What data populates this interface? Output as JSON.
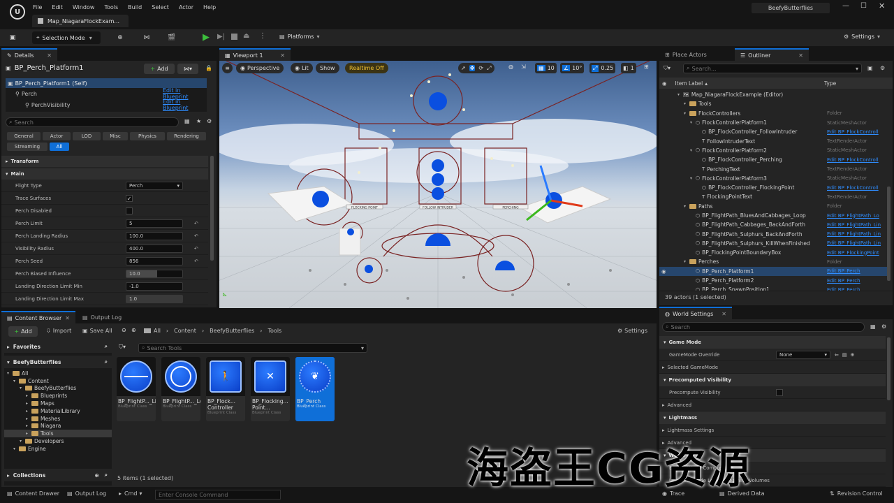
{
  "titlebar": {
    "menus": [
      "File",
      "Edit",
      "Window",
      "Tools",
      "Build",
      "Select",
      "Actor",
      "Help"
    ],
    "project_name": "BeefyButterflies",
    "map_tab": "Map_NiagaraFlockExam..."
  },
  "toolbar": {
    "selection_mode": "Selection Mode",
    "platforms": "Platforms",
    "settings": "Settings"
  },
  "details": {
    "tab": "Details",
    "actor_name": "BP_Perch_Platform1",
    "add_label": "Add",
    "components": [
      {
        "label": "BP_Perch_Platform1 (Self)",
        "link": ""
      },
      {
        "label": "Perch",
        "link": "Edit in Blueprint"
      },
      {
        "label": "PerchVisibility",
        "link": "Edit in Blueprint"
      }
    ],
    "search_placeholder": "Search",
    "filters": [
      "General",
      "Actor",
      "LOD",
      "Misc",
      "Physics",
      "Rendering",
      "Streaming",
      "All"
    ],
    "sections": {
      "transform": "Transform",
      "main": "Main"
    },
    "properties": [
      {
        "label": "Flight Type",
        "value": "Perch",
        "kind": "dropdown"
      },
      {
        "label": "Trace Surfaces",
        "value": "",
        "kind": "check-on"
      },
      {
        "label": "Perch Disabled",
        "value": "",
        "kind": "check-off"
      },
      {
        "label": "Perch Limit",
        "value": "5",
        "kind": "num-reset"
      },
      {
        "label": "Perch Landing Radius",
        "value": "100.0",
        "kind": "num-reset"
      },
      {
        "label": "Visibility Radius",
        "value": "400.0",
        "kind": "num-reset"
      },
      {
        "label": "Perch Seed",
        "value": "856",
        "kind": "num-reset"
      },
      {
        "label": "Perch Biased Influence",
        "value": "10.0",
        "kind": "slider"
      },
      {
        "label": "Landing Direction Limit Min",
        "value": "-1.0",
        "kind": "slider"
      },
      {
        "label": "Landing Direction Limit Max",
        "value": "1.0",
        "kind": "slider"
      }
    ]
  },
  "viewport": {
    "tab": "Viewport 1",
    "perspective": "Perspective",
    "lit": "Lit",
    "show": "Show",
    "realtime": "Realtime Off",
    "grid_snap": "10",
    "rot_snap": "10°",
    "scale_snap": "0.25",
    "cam_speed": "1",
    "labels": [
      "FLOCKING POINT",
      "FOLLOW INTRUDER",
      "PERCHING"
    ]
  },
  "place_actors": {
    "tab": "Place Actors"
  },
  "outliner": {
    "tab": "Outliner",
    "search_placeholder": "Search...",
    "col_label": "Item Label",
    "col_type": "Type",
    "rows": [
      {
        "label": "Map_NiagaraFlockExample (Editor)",
        "type": "",
        "indent": 1,
        "icon": "map",
        "link": false
      },
      {
        "label": "Tools",
        "type": "",
        "indent": 2,
        "icon": "folder",
        "link": false
      },
      {
        "label": "FlockControllers",
        "type": "Folder",
        "indent": 2,
        "icon": "folder",
        "link": false
      },
      {
        "label": "FlockControllerPlatform1",
        "type": "StaticMeshActor",
        "indent": 3,
        "icon": "mesh",
        "link": false
      },
      {
        "label": "BP_FlockController_FollowIntruder",
        "type": "Edit BP_FlockControll",
        "indent": 4,
        "icon": "bp",
        "link": true
      },
      {
        "label": "FollowIntruderText",
        "type": "TextRenderActor",
        "indent": 4,
        "icon": "text",
        "link": false
      },
      {
        "label": "FlockControllerPlatform2",
        "type": "StaticMeshActor",
        "indent": 3,
        "icon": "mesh",
        "link": false
      },
      {
        "label": "BP_FlockController_Perching",
        "type": "Edit BP_FlockControll",
        "indent": 4,
        "icon": "bp",
        "link": true
      },
      {
        "label": "PerchingText",
        "type": "TextRenderActor",
        "indent": 4,
        "icon": "text",
        "link": false
      },
      {
        "label": "FlockControllerPlatform3",
        "type": "StaticMeshActor",
        "indent": 3,
        "icon": "mesh",
        "link": false
      },
      {
        "label": "BP_FlockController_FlockingPoint",
        "type": "Edit BP_FlockControll",
        "indent": 4,
        "icon": "bp",
        "link": true
      },
      {
        "label": "FlockingPointText",
        "type": "TextRenderActor",
        "indent": 4,
        "icon": "text",
        "link": false
      },
      {
        "label": "Paths",
        "type": "Folder",
        "indent": 2,
        "icon": "folder",
        "link": false
      },
      {
        "label": "BP_FlightPath_BluesAndCabbages_Loop",
        "type": "Edit BP_FlightPath_Lo",
        "indent": 3,
        "icon": "bp",
        "link": true
      },
      {
        "label": "BP_FlightPath_Cabbages_BackAndForth",
        "type": "Edit BP_FlightPath_Lin",
        "indent": 3,
        "icon": "bp",
        "link": true
      },
      {
        "label": "BP_FlightPath_Sulphurs_BackAndForth",
        "type": "Edit BP_FlightPath_Lin",
        "indent": 3,
        "icon": "bp",
        "link": true
      },
      {
        "label": "BP_FlightPath_Sulphurs_KillWhenFinished",
        "type": "Edit BP_FlightPath_Lin",
        "indent": 3,
        "icon": "bp",
        "link": true
      },
      {
        "label": "BP_FlockingPointBoundaryBox",
        "type": "Edit BP_FlockingPoint",
        "indent": 3,
        "icon": "bp",
        "link": true
      },
      {
        "label": "Perches",
        "type": "Folder",
        "indent": 2,
        "icon": "folder",
        "link": false
      },
      {
        "label": "BP_Perch_Platform1",
        "type": "Edit BP_Perch",
        "indent": 3,
        "icon": "bp",
        "link": true,
        "selected": true
      },
      {
        "label": "BP_Perch_Platform2",
        "type": "Edit BP_Perch",
        "indent": 3,
        "icon": "bp",
        "link": true
      },
      {
        "label": "BP_Perch_SpawnPosition1",
        "type": "Edit BP_Perch",
        "indent": 3,
        "icon": "bp",
        "link": true
      }
    ],
    "status": "39 actors (1 selected)"
  },
  "world_settings": {
    "tab": "World Settings",
    "search_placeholder": "Search",
    "sections": [
      "Game Mode",
      "Precomputed Visibility",
      "Lightmass",
      "World"
    ],
    "gamemode_override_label": "GameMode Override",
    "gamemode_override_value": "None",
    "selected_gamemode": "Selected GameMode",
    "precompute_visibility": "Precompute Visibility",
    "advanced": "Advanced",
    "lightmass_settings": "Lightmass Settings",
    "enable_world_composition": "Enable World Composition",
    "use_client_side": "Use Client Side Level Streaming Volumes"
  },
  "content_browser": {
    "tab": "Content Browser",
    "output_tab": "Output Log",
    "add": "Add",
    "import": "Import",
    "save_all": "Save All",
    "breadcrumb": [
      "All",
      "Content",
      "BeefyButterflies",
      "Tools"
    ],
    "settings": "Settings",
    "favorites": "Favorites",
    "project": "BeefyButterflies",
    "tree": [
      {
        "label": "All",
        "indent": 0
      },
      {
        "label": "Content",
        "indent": 1
      },
      {
        "label": "BeefyButterflies",
        "indent": 2
      },
      {
        "label": "Blueprints",
        "indent": 3
      },
      {
        "label": "Maps",
        "indent": 3
      },
      {
        "label": "MaterialLibrary",
        "indent": 3
      },
      {
        "label": "Meshes",
        "indent": 3
      },
      {
        "label": "Niagara",
        "indent": 3
      },
      {
        "label": "Tools",
        "indent": 3,
        "selected": true
      },
      {
        "label": "Developers",
        "indent": 2
      },
      {
        "label": "Engine",
        "indent": 1
      }
    ],
    "collections": "Collections",
    "search_placeholder": "Search Tools",
    "assets": [
      {
        "name": "BP_FlightP..._Line",
        "sub": "Blueprint Class",
        "glyph": "line"
      },
      {
        "name": "BP_FlightP..._Loop",
        "sub": "Blueprint Class",
        "glyph": "loop"
      },
      {
        "name": "BP_Flock... Controller",
        "sub": "Blueprint Class",
        "glyph": "person"
      },
      {
        "name": "BP_Flocking... Point...",
        "sub": "Blueprint Class",
        "glyph": "butterfly"
      },
      {
        "name": "BP_Perch",
        "sub": "Blueprint Class",
        "glyph": "perch",
        "selected": true
      }
    ],
    "status": "5 items (1 selected)"
  },
  "statusbar": {
    "content_drawer": "Content Drawer",
    "output_log": "Output Log",
    "cmd": "Cmd",
    "console_placeholder": "Enter Console Command",
    "trace": "Trace",
    "derived_data": "Derived Data",
    "revision": "Revision Control"
  },
  "watermark": "海盗王CG资源"
}
